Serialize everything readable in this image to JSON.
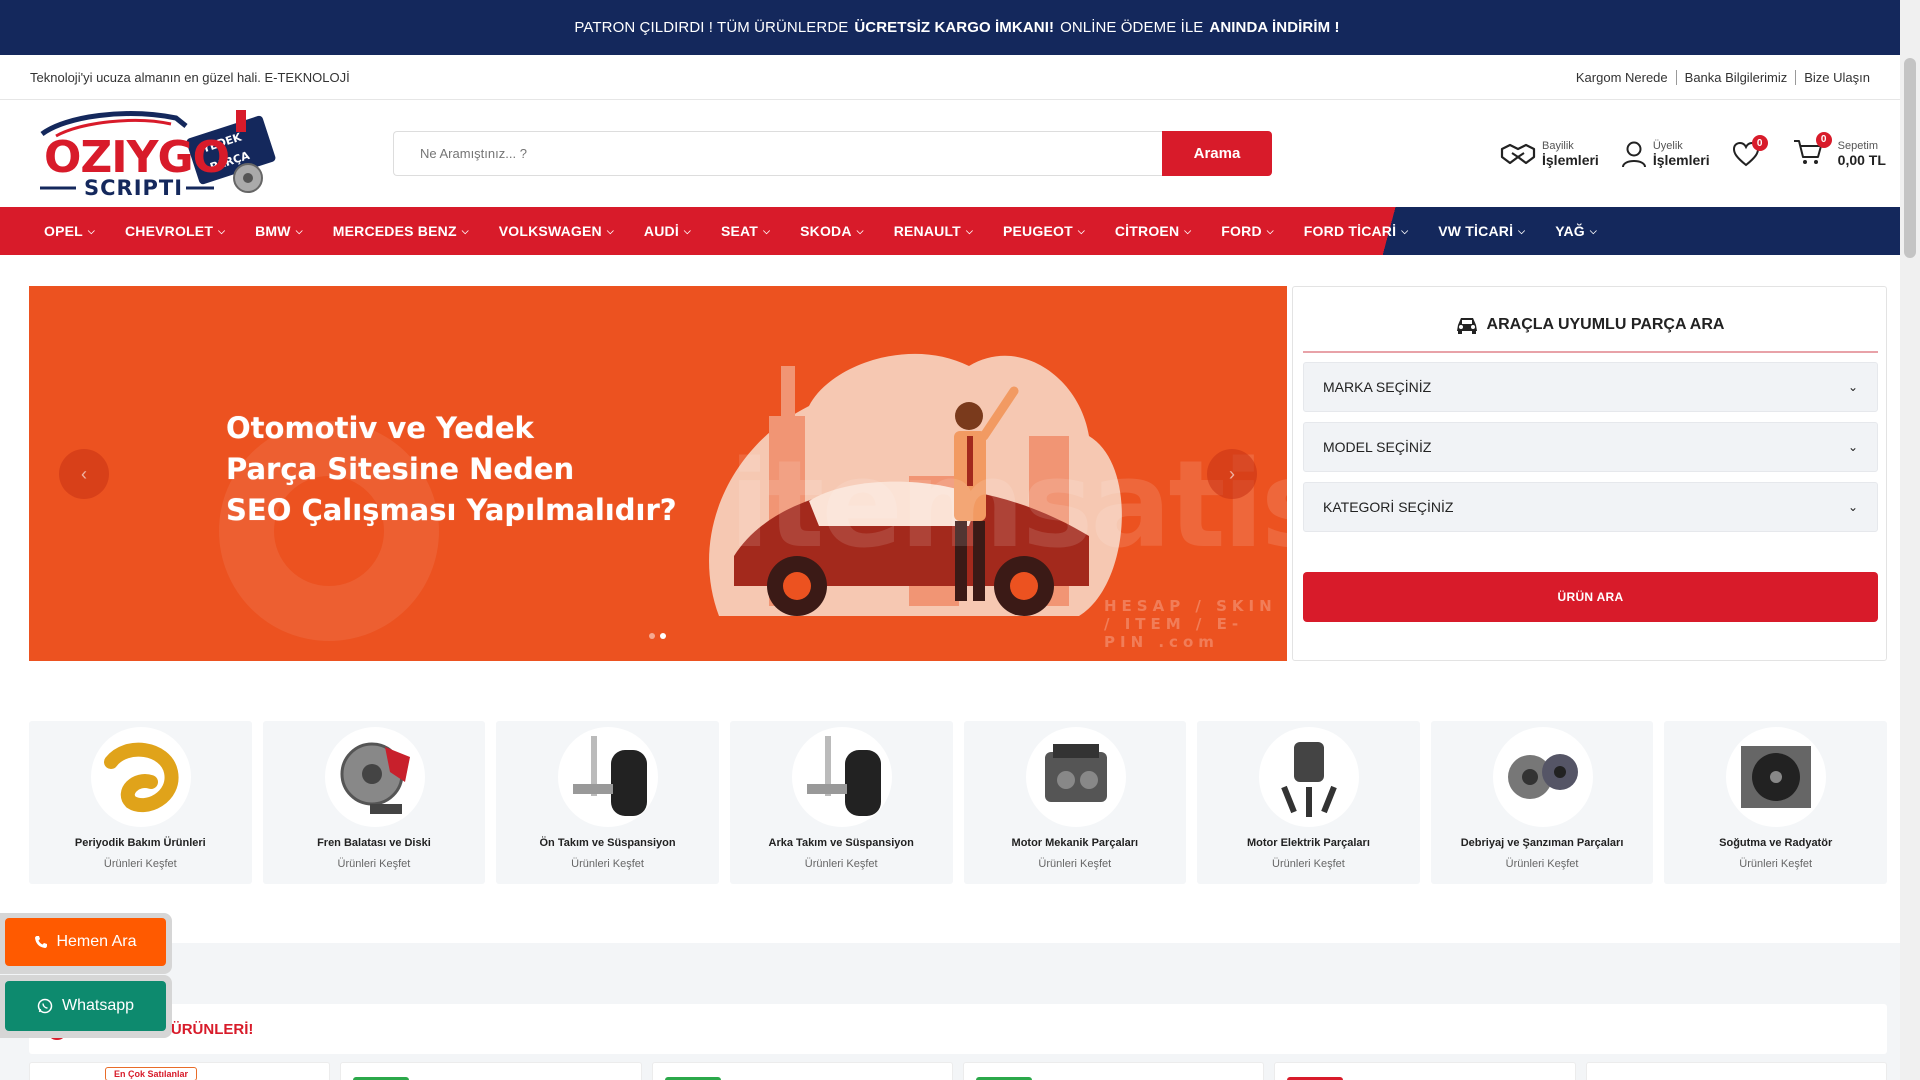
{
  "announcement": {
    "part1": "PATRON ÇILDIRDI ! TÜM ÜRÜNLERDE",
    "bold1": "ÜCRETSİZ KARGO İMKANI!",
    "part2": "ONLİNE ÖDEME İLE",
    "bold2": "ANINDA İNDİRİM !"
  },
  "infobar": {
    "slogan": "Teknoloji'yi ucuza almanın en güzel hali. E-TEKNOLOJİ",
    "links": [
      "Kargom Nerede",
      "Banka Bilgilerimiz",
      "Bize Ulaşın"
    ]
  },
  "logo": {
    "main": "OZIYGO",
    "sub": "SCRIPTI",
    "badge_top": "YEDEK",
    "badge_bottom": "PARÇA"
  },
  "search": {
    "placeholder": "Ne Aramıştınız... ?",
    "button": "Arama"
  },
  "header_actions": {
    "dealer_small": "Bayilik",
    "dealer_big": "İşlemleri",
    "member_small": "Üyelik",
    "member_big": "İşlemleri",
    "wishlist_count": "0",
    "cart_count": "0",
    "cart_small": "Sepetim",
    "cart_total": "0,00 TL"
  },
  "nav": [
    "OPEL",
    "CHEVROLET",
    "BMW",
    "MERCEDES BENZ",
    "VOLKSWAGEN",
    "AUDİ",
    "SEAT",
    "SKODA",
    "RENAULT",
    "PEUGEOT",
    "CİTROEN",
    "FORD",
    "FORD TİCARİ",
    "VW TİCARİ",
    "YAĞ"
  ],
  "slider": {
    "title": "Otomotiv ve Yedek\nParça Sitesine Neden\nSEO Çalışması Yapılmalıdır?",
    "watermark": "itemsatis",
    "watermark_sub": "HESAP / SKIN / ITEM / E-PIN  .com",
    "prev": "‹",
    "next": "›"
  },
  "finder": {
    "title": "ARAÇLA UYUMLU PARÇA ARA",
    "brand": "MARKA SEÇİNİZ",
    "model": "MODEL SEÇİNİZ",
    "category": "KATEGORİ SEÇİNİZ",
    "button": "ÜRÜN ARA"
  },
  "categories": [
    {
      "name": "Periyodik Bakım Ürünleri",
      "sub": "Ürünleri Keşfet"
    },
    {
      "name": "Fren Balatası ve Diski",
      "sub": "Ürünleri Keşfet"
    },
    {
      "name": "Ön Takım ve Süspansiyon",
      "sub": "Ürünleri Keşfet"
    },
    {
      "name": "Arka Takım ve Süspansiyon",
      "sub": "Ürünleri Keşfet"
    },
    {
      "name": "Motor Mekanik Parçaları",
      "sub": "Ürünleri Keşfet"
    },
    {
      "name": "Motor Elektrik Parçaları",
      "sub": "Ürünleri Keşfet"
    },
    {
      "name": "Debriyaj ve Şanzıman Parçaları",
      "sub": "Ürünleri Keşfet"
    },
    {
      "name": "Soğutma ve Radyatör",
      "sub": "Ürünleri Keşfet"
    }
  ],
  "section": {
    "title": "SON FIRSAT ÜRÜNLERİ!",
    "bestseller": "En Çok Satılanlar"
  },
  "floating": {
    "call": "Hemen Ara",
    "whatsapp": "Whatsapp"
  },
  "colors": {
    "navy": "#14285c",
    "red": "#d81b2a",
    "orange": "#ec5220",
    "green": "#0d8a6e"
  }
}
